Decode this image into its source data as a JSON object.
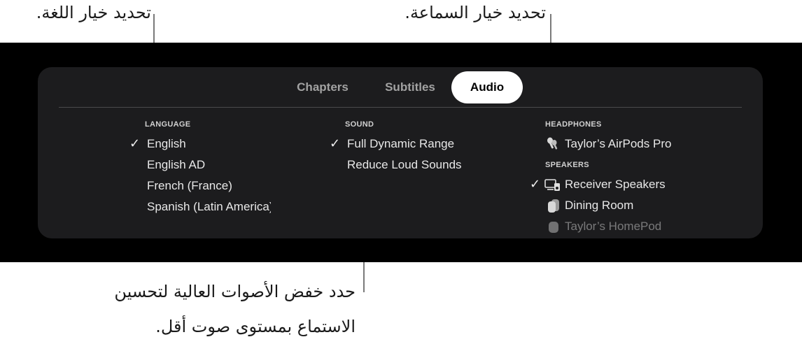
{
  "callouts": {
    "language": "تحديد خيار اللغة.",
    "speaker": "تحديد خيار السماعة.",
    "reduce_line1": "حدد خفض الأصوات العالية لتحسين",
    "reduce_line2": "الاستماع بمستوى صوت أقل."
  },
  "tabs": [
    {
      "label": "Chapters",
      "selected": false
    },
    {
      "label": "Subtitles",
      "selected": false
    },
    {
      "label": "Audio",
      "selected": true
    }
  ],
  "language": {
    "title": "LANGUAGE",
    "options": [
      {
        "label": "English",
        "checked": true
      },
      {
        "label": "English AD",
        "checked": false
      },
      {
        "label": "French (France)",
        "checked": false
      },
      {
        "label": "Spanish (Latin America)",
        "checked": false
      }
    ]
  },
  "sound": {
    "title": "SOUND",
    "options": [
      {
        "label": "Full Dynamic Range",
        "checked": true
      },
      {
        "label": "Reduce Loud Sounds",
        "checked": false
      }
    ]
  },
  "headphones": {
    "title": "HEADPHONES",
    "options": [
      {
        "label": "Taylor’s AirPods Pro",
        "icon": "airpods-icon"
      }
    ]
  },
  "speakers": {
    "title": "SPEAKERS",
    "options": [
      {
        "label": "Receiver Speakers",
        "icon": "receiver-speakers-icon",
        "checked": true
      },
      {
        "label": "Dining Room",
        "icon": "homepod-icon",
        "checked": false
      },
      {
        "label": "Taylor’s HomePod",
        "icon": "homepod-mini-icon",
        "checked": false
      }
    ]
  },
  "colors": {
    "panel_bg": "#1c1c1e",
    "screen_bg": "#000000",
    "selected_tab_bg": "#ffffff"
  }
}
